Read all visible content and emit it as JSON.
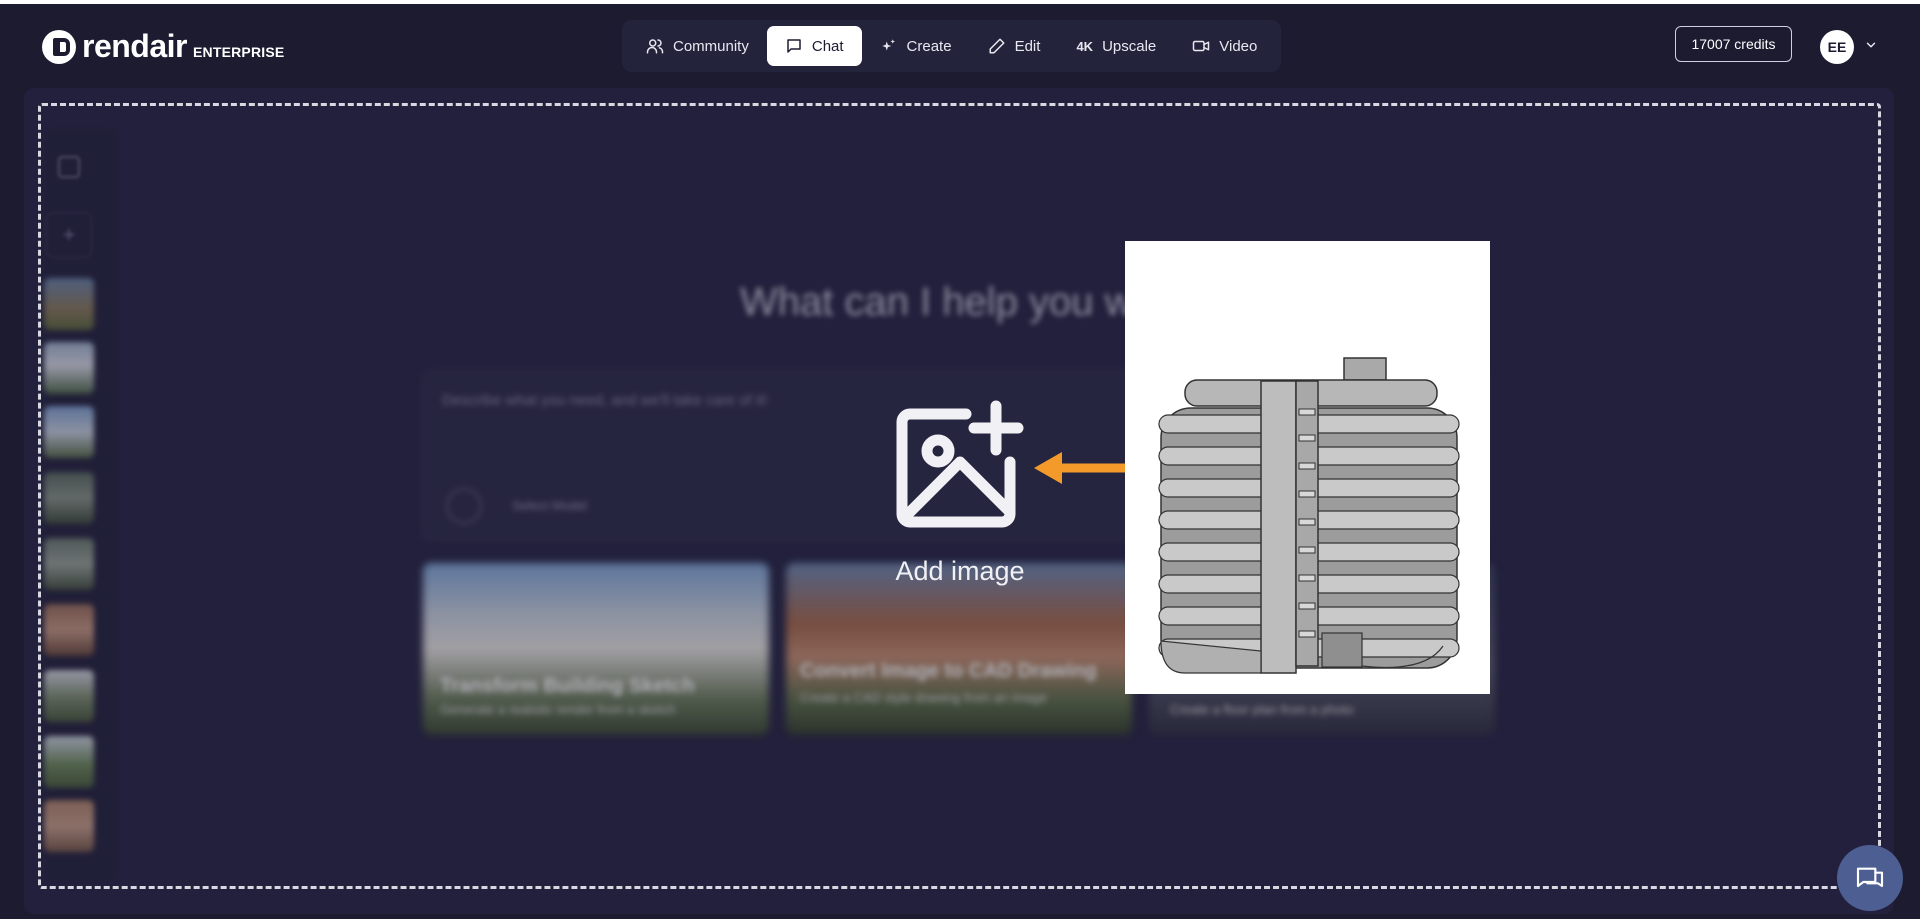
{
  "app": {
    "logo_word": "rendair",
    "logo_suffix": "ENTERPRISE"
  },
  "nav": {
    "items": [
      {
        "label": "Community",
        "icon": "users-icon",
        "active": false
      },
      {
        "label": "Chat",
        "icon": "chat-icon",
        "active": true
      },
      {
        "label": "Create",
        "icon": "sparkles-icon",
        "active": false
      },
      {
        "label": "Edit",
        "icon": "pencil-icon",
        "active": false
      },
      {
        "label": "Upscale",
        "prefix": "4K",
        "icon": "4k-icon",
        "active": false
      },
      {
        "label": "Video",
        "icon": "video-icon",
        "active": false
      }
    ]
  },
  "account": {
    "credits": "17007 credits",
    "avatar_initials": "EE"
  },
  "background": {
    "title": "What can I help you wi",
    "prompt_placeholder": "Describe what you need, and we'll take care of it!",
    "model_select": "Select Model",
    "cards": [
      {
        "title": "Transform Building Sketch",
        "subtitle": "Generate a realistic render from a sketch"
      },
      {
        "title": "Convert Image to CAD Drawing",
        "subtitle": "Create a CAD style drawing from an image"
      },
      {
        "title": "",
        "subtitle": "Create a floor plan from a photo"
      }
    ]
  },
  "dropzone": {
    "label": "Add image",
    "icon": "image-plus-icon"
  },
  "colors": {
    "background": "#1c1b30",
    "panel": "#252442",
    "accent_arrow": "#f39a2b",
    "chat_bubble": "#4d5f92"
  }
}
